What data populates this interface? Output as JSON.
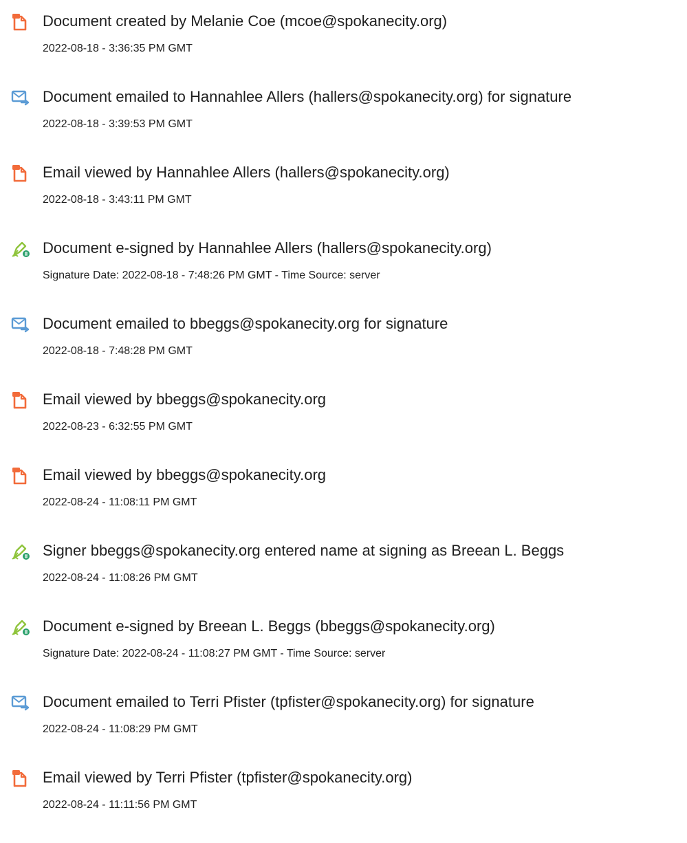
{
  "colors": {
    "document_icon": "#f26b3a",
    "email_icon": "#5b9bd5",
    "sign_icon_pen": "#8fc43c",
    "sign_icon_badge": "#29a06b",
    "text": "#1f1f1f"
  },
  "events": [
    {
      "icon": "document-icon",
      "title": "Document created by Melanie Coe (mcoe@spokanecity.org)",
      "detail": "2022-08-18 - 3:36:35 PM GMT"
    },
    {
      "icon": "email-sent-icon",
      "title": "Document emailed to Hannahlee Allers (hallers@spokanecity.org) for signature",
      "detail": "2022-08-18 - 3:39:53 PM GMT"
    },
    {
      "icon": "document-icon",
      "title": "Email viewed by Hannahlee Allers (hallers@spokanecity.org)",
      "detail": "2022-08-18 - 3:43:11 PM GMT"
    },
    {
      "icon": "e-sign-icon",
      "title": "Document e-signed by Hannahlee Allers (hallers@spokanecity.org)",
      "detail": "Signature Date: 2022-08-18 - 7:48:26 PM GMT - Time Source: server"
    },
    {
      "icon": "email-sent-icon",
      "title": "Document emailed to bbeggs@spokanecity.org for signature",
      "detail": "2022-08-18 - 7:48:28 PM GMT"
    },
    {
      "icon": "document-icon",
      "title": "Email viewed by bbeggs@spokanecity.org",
      "detail": "2022-08-23 - 6:32:55 PM GMT"
    },
    {
      "icon": "document-icon",
      "title": "Email viewed by bbeggs@spokanecity.org",
      "detail": "2022-08-24 - 11:08:11 PM GMT"
    },
    {
      "icon": "e-sign-icon",
      "title": "Signer bbeggs@spokanecity.org entered name at signing as Breean L. Beggs",
      "detail": "2022-08-24 - 11:08:26 PM GMT"
    },
    {
      "icon": "e-sign-icon",
      "title": "Document e-signed by Breean L. Beggs (bbeggs@spokanecity.org)",
      "detail": "Signature Date: 2022-08-24 - 11:08:27 PM GMT - Time Source: server"
    },
    {
      "icon": "email-sent-icon",
      "title": "Document emailed to Terri Pfister (tpfister@spokanecity.org) for signature",
      "detail": "2022-08-24 - 11:08:29 PM GMT"
    },
    {
      "icon": "document-icon",
      "title": "Email viewed by Terri Pfister (tpfister@spokanecity.org)",
      "detail": "2022-08-24 - 11:11:56 PM GMT"
    }
  ]
}
